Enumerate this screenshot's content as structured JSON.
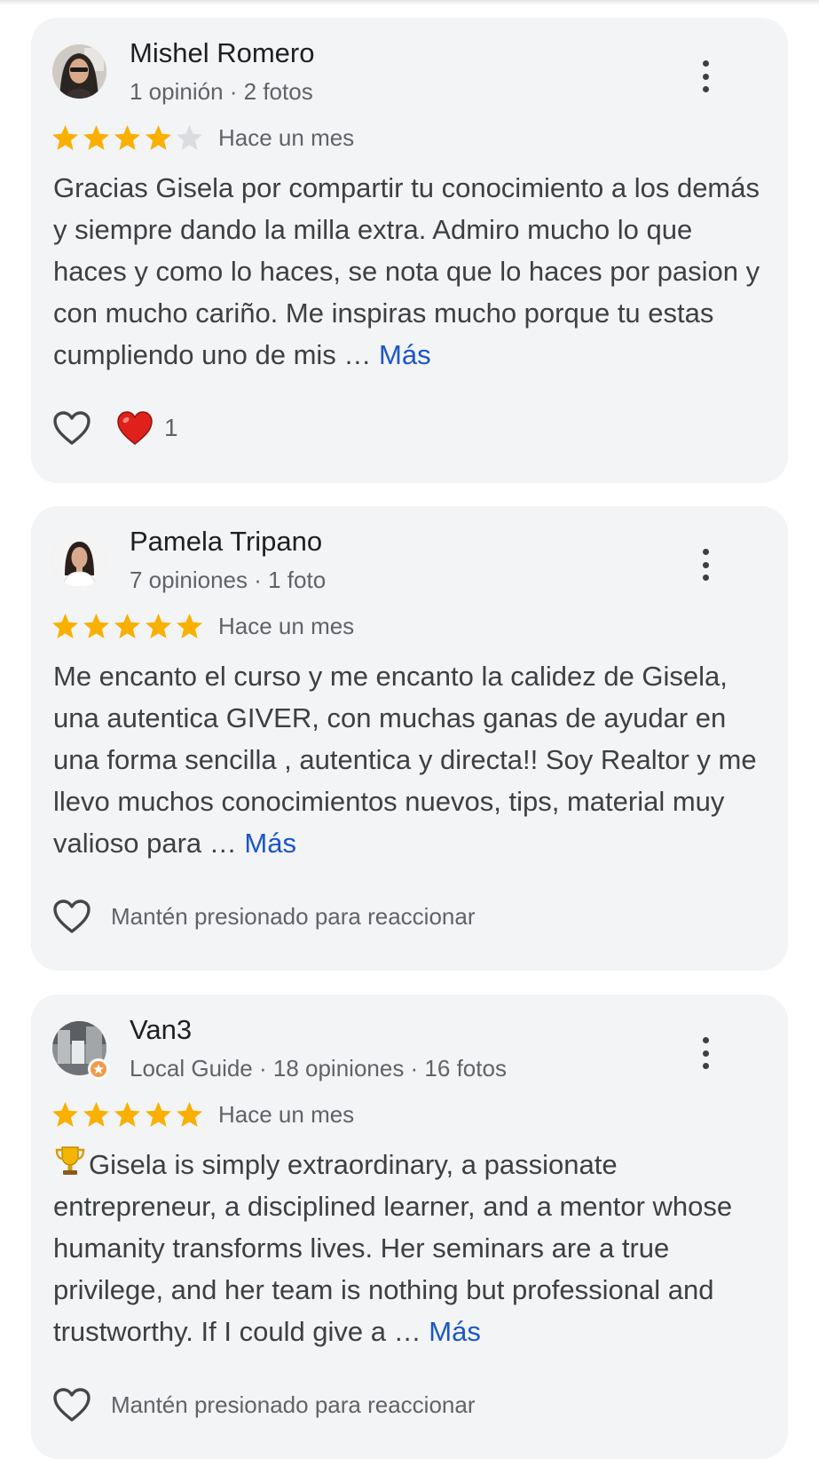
{
  "colors": {
    "card_bg": "#f3f4f6",
    "star_filled": "#f9b000",
    "star_empty": "#dadce0",
    "link": "#1a56c8",
    "reaction_red": "#e0211b"
  },
  "reviews": [
    {
      "author": "Mishel Romero",
      "meta": "1 opinión · 2 fotos",
      "rating": 4,
      "date": "Hace un mes",
      "text": "Gracias Gisela por compartir tu conocimiento a los demás y siempre dando la milla extra. Admiro mucho lo que haces y como lo haces, se nota que lo haces por pasion y con mucho cariño. Me inspiras mucho porque tu estas cumpliendo uno de mis …",
      "more_label": "Más",
      "reaction_count": "1"
    },
    {
      "author": "Pamela Tripano",
      "meta": "7 opiniones · 1 foto",
      "rating": 5,
      "date": "Hace un mes",
      "text": "Me encanto el curso y me encanto la calidez de Gisela, una autentica GIVER, con muchas ganas de ayudar en una forma sencilla , autentica y directa!! Soy Realtor y me llevo muchos conocimientos nuevos, tips, material muy valioso para …",
      "more_label": "Más",
      "reaction_hint": "Mantén presionado para reaccionar"
    },
    {
      "author": "Van3",
      "meta": "Local Guide · 18 opiniones · 16 fotos",
      "rating": 5,
      "date": "Hace un mes",
      "text": "Gisela is simply extraordinary, a passionate entrepreneur, a disciplined learner, and a mentor whose humanity transforms lives. Her seminars are a true privilege, and her team is nothing but professional and trustworthy. If I could give a …",
      "text_prefix_icon": "trophy-emoji",
      "more_label": "Más",
      "reaction_hint": "Mantén presionado para reaccionar"
    }
  ]
}
